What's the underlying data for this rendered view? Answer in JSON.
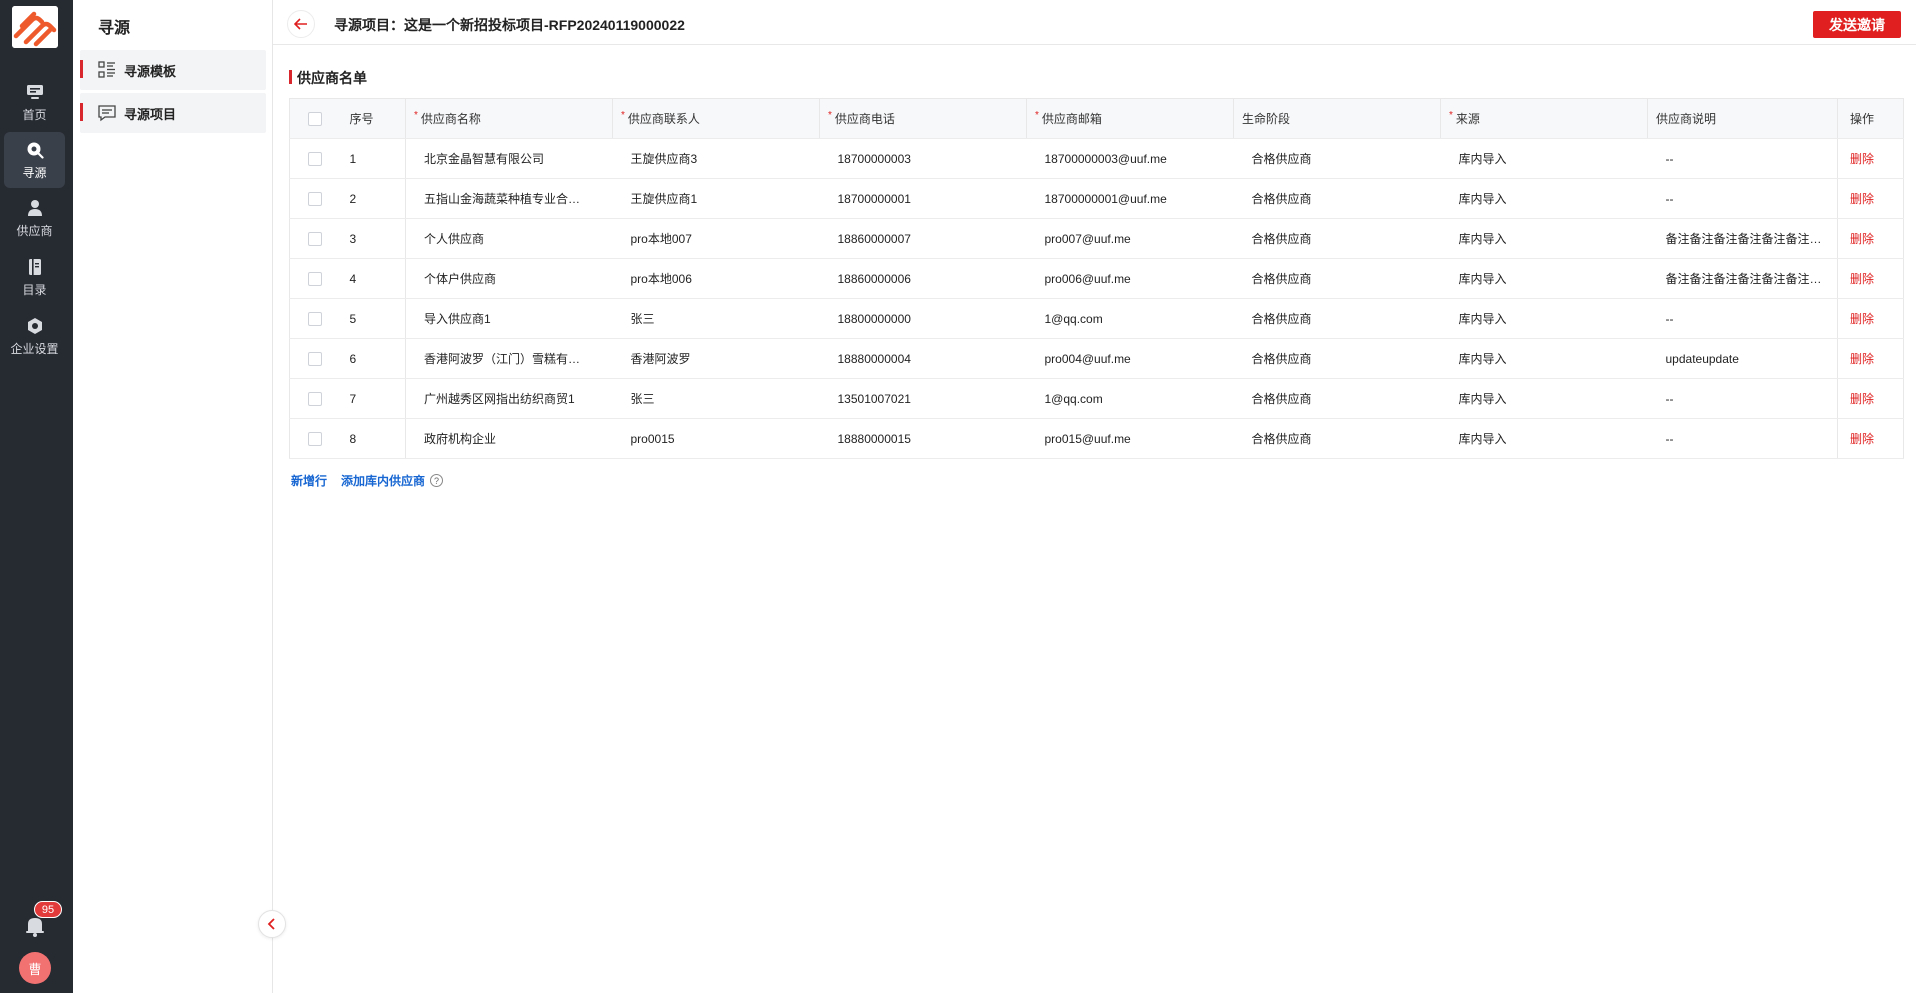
{
  "rail": {
    "items": [
      {
        "label": "首页",
        "icon": "home-icon"
      },
      {
        "label": "寻源",
        "icon": "sourcing-icon"
      },
      {
        "label": "供应商",
        "icon": "supplier-icon"
      },
      {
        "label": "目录",
        "icon": "catalog-icon"
      },
      {
        "label": "企业设置",
        "icon": "settings-icon"
      }
    ],
    "notification_count": "95",
    "avatar_text": "曹"
  },
  "subnav": {
    "title": "寻源",
    "items": [
      {
        "label": "寻源模板",
        "icon": "template-list-icon"
      },
      {
        "label": "寻源项目",
        "icon": "project-chat-icon"
      }
    ]
  },
  "header": {
    "title": "寻源项目：这是一个新招投标项目-RFP20240119000022",
    "send_button": "发送邀请"
  },
  "section": {
    "title": "供应商名单"
  },
  "table": {
    "headers": {
      "no": "序号",
      "name": "供应商名称",
      "contact": "供应商联系人",
      "phone": "供应商电话",
      "email": "供应商邮箱",
      "stage": "生命阶段",
      "source": "来源",
      "desc": "供应商说明",
      "op": "操作"
    },
    "rows": [
      {
        "no": "1",
        "name": "北京金晶智慧有限公司",
        "contact": "王旋供应商3",
        "phone": "18700000003",
        "email": "18700000003@uuf.me",
        "stage": "合格供应商",
        "source": "库内导入",
        "desc": "--",
        "op": "删除"
      },
      {
        "no": "2",
        "name": "五指山金海蔬菜种植专业合…",
        "contact": "王旋供应商1",
        "phone": "18700000001",
        "email": "18700000001@uuf.me",
        "stage": "合格供应商",
        "source": "库内导入",
        "desc": "--",
        "op": "删除"
      },
      {
        "no": "3",
        "name": "个人供应商",
        "contact": "pro本地007",
        "phone": "18860000007",
        "email": "pro007@uuf.me",
        "stage": "合格供应商",
        "source": "库内导入",
        "desc": "备注备注备注备注备注备注…",
        "op": "删除"
      },
      {
        "no": "4",
        "name": "个体户供应商",
        "contact": "pro本地006",
        "phone": "18860000006",
        "email": "pro006@uuf.me",
        "stage": "合格供应商",
        "source": "库内导入",
        "desc": "备注备注备注备注备注备注…",
        "op": "删除"
      },
      {
        "no": "5",
        "name": "导入供应商1",
        "contact": "张三",
        "phone": "18800000000",
        "email": "1@qq.com",
        "stage": "合格供应商",
        "source": "库内导入",
        "desc": "--",
        "op": "删除"
      },
      {
        "no": "6",
        "name": "香港阿波罗（江门）雪糕有…",
        "contact": "香港阿波罗",
        "phone": "18880000004",
        "email": "pro004@uuf.me",
        "stage": "合格供应商",
        "source": "库内导入",
        "desc": "updateupdate",
        "op": "删除"
      },
      {
        "no": "7",
        "name": "广州越秀区网指出纺织商贸1",
        "contact": "张三",
        "phone": "13501007021",
        "email": "1@qq.com",
        "stage": "合格供应商",
        "source": "库内导入",
        "desc": "--",
        "op": "删除"
      },
      {
        "no": "8",
        "name": "政府机构企业",
        "contact": "pro0015",
        "phone": "18880000015",
        "email": "pro015@uuf.me",
        "stage": "合格供应商",
        "source": "库内导入",
        "desc": "--",
        "op": "删除"
      }
    ]
  },
  "actions": {
    "add_row": "新增行",
    "add_from_library": "添加库内供应商"
  },
  "colors": {
    "accent": "#e02020",
    "link": "#1766d2",
    "rail_bg": "#262a31"
  }
}
